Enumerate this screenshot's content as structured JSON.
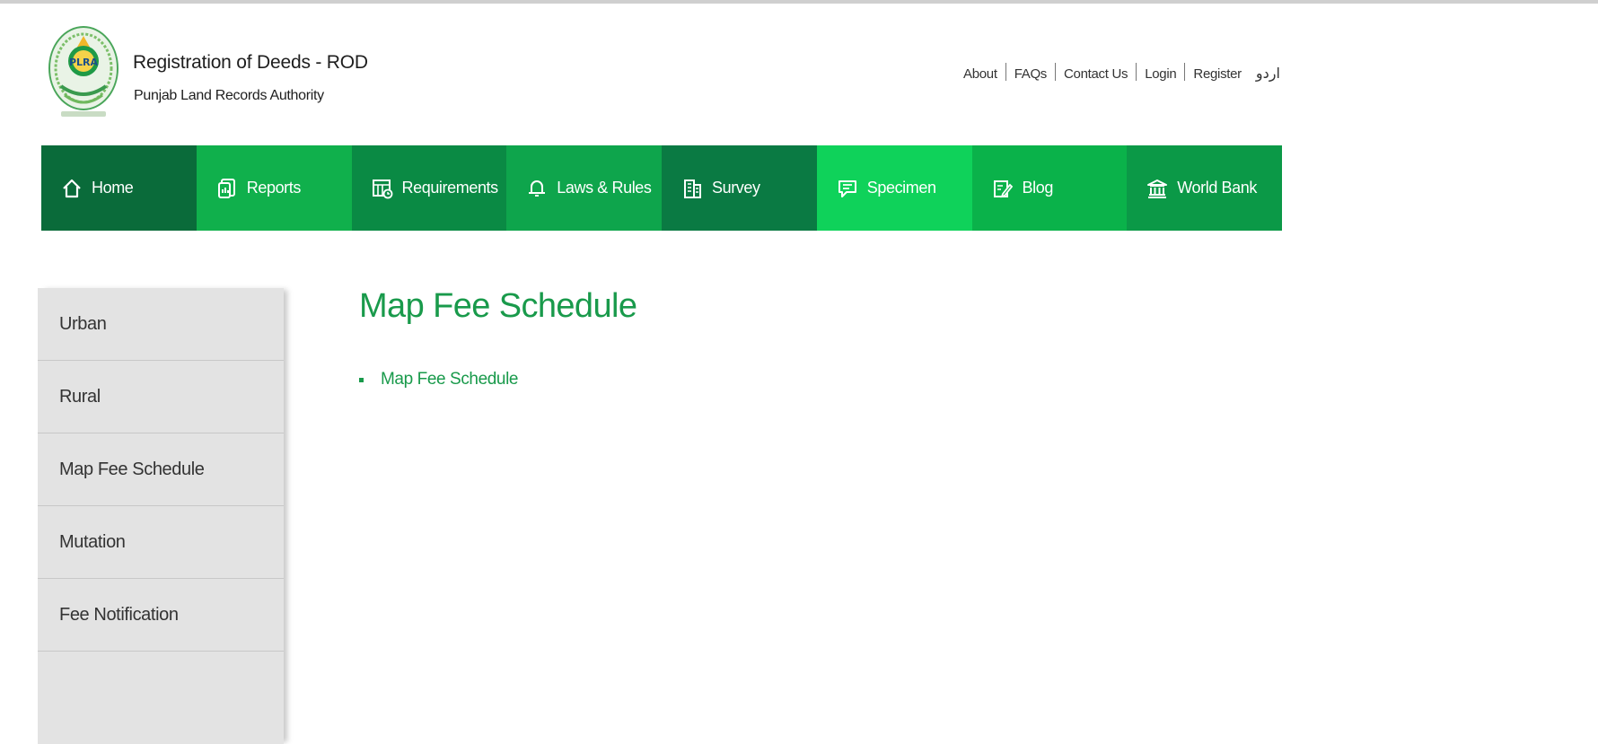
{
  "header": {
    "title": "Registration of Deeds - ROD",
    "subtitle": "Punjab Land Records Authority",
    "logo_text": "PLRA",
    "top_links": [
      "About",
      "FAQs",
      "Contact Us",
      "Login",
      "Register"
    ],
    "language_link": "اردو"
  },
  "nav": {
    "items": [
      {
        "label": "Home",
        "icon": "home-icon",
        "color": "#0a6b3a"
      },
      {
        "label": "Reports",
        "icon": "reports-icon",
        "color": "#10b04c"
      },
      {
        "label": "Requirements",
        "icon": "requirements-icon",
        "color": "#0a8a44"
      },
      {
        "label": "Laws & Rules",
        "icon": "bell-icon",
        "color": "#0ea54c"
      },
      {
        "label": "Survey",
        "icon": "building-icon",
        "color": "#0a7a43"
      },
      {
        "label": "Specimen",
        "icon": "chat-icon",
        "color": "#0fd25a"
      },
      {
        "label": "Blog",
        "icon": "edit-icon",
        "color": "#0ab24a"
      },
      {
        "label": "World Bank",
        "icon": "bank-icon",
        "color": "#0b9947"
      }
    ]
  },
  "sidebar": {
    "items": [
      {
        "label": "Urban"
      },
      {
        "label": "Rural"
      },
      {
        "label": "Map Fee Schedule"
      },
      {
        "label": "Mutation"
      },
      {
        "label": "Fee Notification"
      }
    ]
  },
  "main": {
    "title": "Map Fee Schedule",
    "links": [
      {
        "label": "Map Fee Schedule"
      }
    ]
  },
  "colors": {
    "accent": "#199a4b",
    "sidebar_bg": "#e3e3e3"
  }
}
